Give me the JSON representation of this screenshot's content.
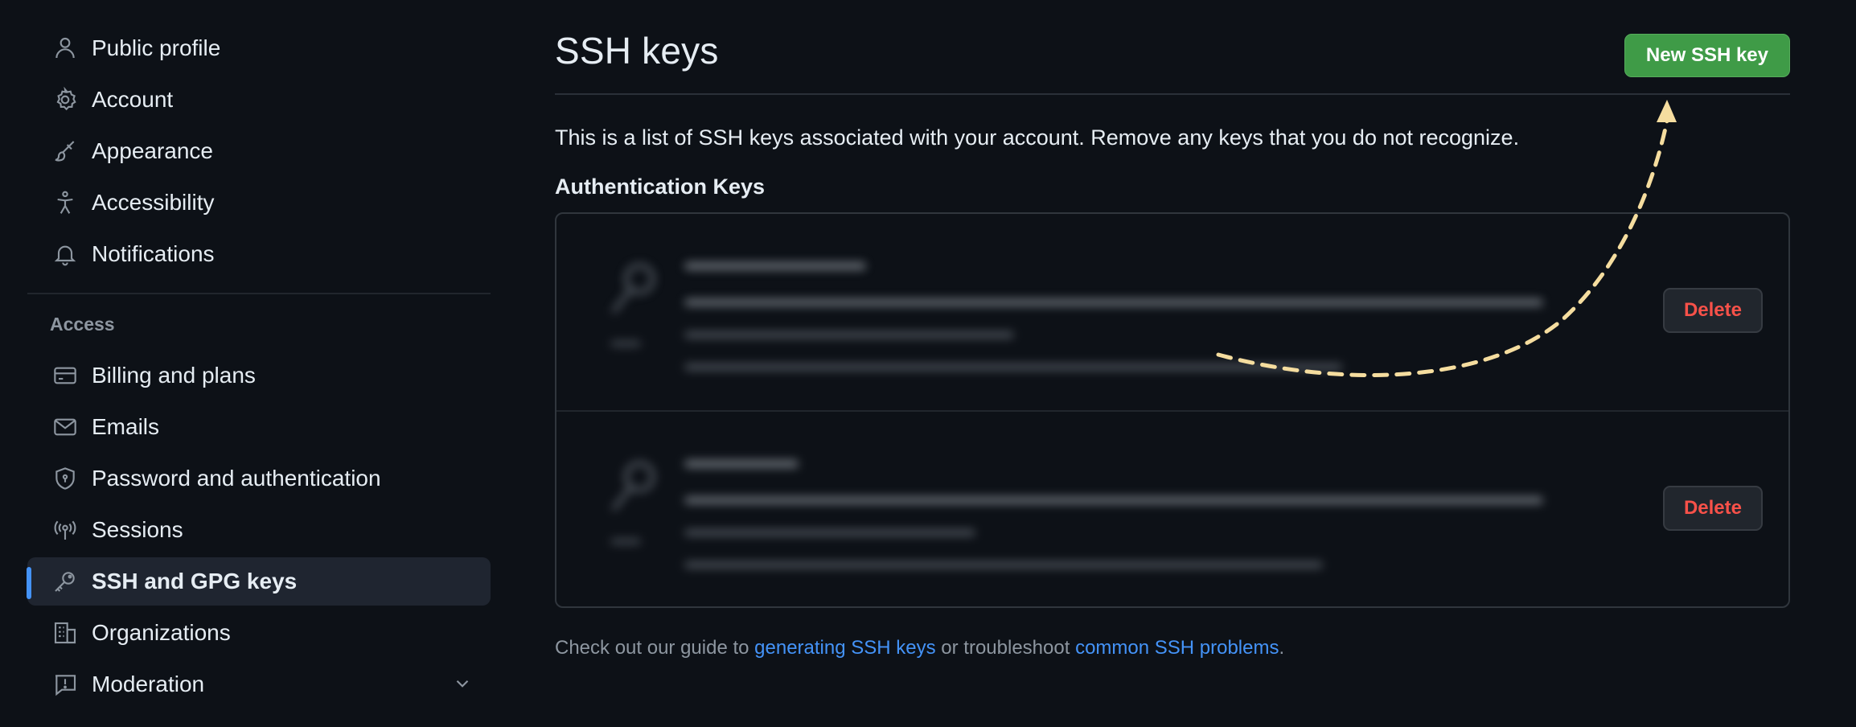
{
  "sidebar": {
    "items_top": [
      {
        "label": "Public profile",
        "icon": "person-icon"
      },
      {
        "label": "Account",
        "icon": "gear-icon"
      },
      {
        "label": "Appearance",
        "icon": "paintbrush-icon"
      },
      {
        "label": "Accessibility",
        "icon": "accessibility-icon"
      },
      {
        "label": "Notifications",
        "icon": "bell-icon"
      }
    ],
    "access_heading": "Access",
    "items_access": [
      {
        "label": "Billing and plans",
        "icon": "credit-card-icon"
      },
      {
        "label": "Emails",
        "icon": "mail-icon"
      },
      {
        "label": "Password and authentication",
        "icon": "shield-lock-icon"
      },
      {
        "label": "Sessions",
        "icon": "broadcast-icon"
      },
      {
        "label": "SSH and GPG keys",
        "icon": "key-icon",
        "active": true
      },
      {
        "label": "Organizations",
        "icon": "organization-icon"
      },
      {
        "label": "Moderation",
        "icon": "report-icon"
      }
    ]
  },
  "main": {
    "title": "SSH keys",
    "new_button": "New SSH key",
    "description": "This is a list of SSH keys associated with your account. Remove any keys that you do not recognize.",
    "auth_heading": "Authentication Keys",
    "keys": [
      {
        "delete_label": "Delete"
      },
      {
        "delete_label": "Delete"
      }
    ],
    "guide": {
      "prefix": "Check out our guide to ",
      "link1": "generating SSH keys",
      "middle": " or troubleshoot ",
      "link2": "common SSH problems",
      "suffix": "."
    }
  },
  "colors": {
    "background": "#0d1117",
    "accent": "#4493f8",
    "primary_button": "#3f9b47",
    "danger": "#f85149",
    "annotation_arrow": "#f5dd9f"
  }
}
